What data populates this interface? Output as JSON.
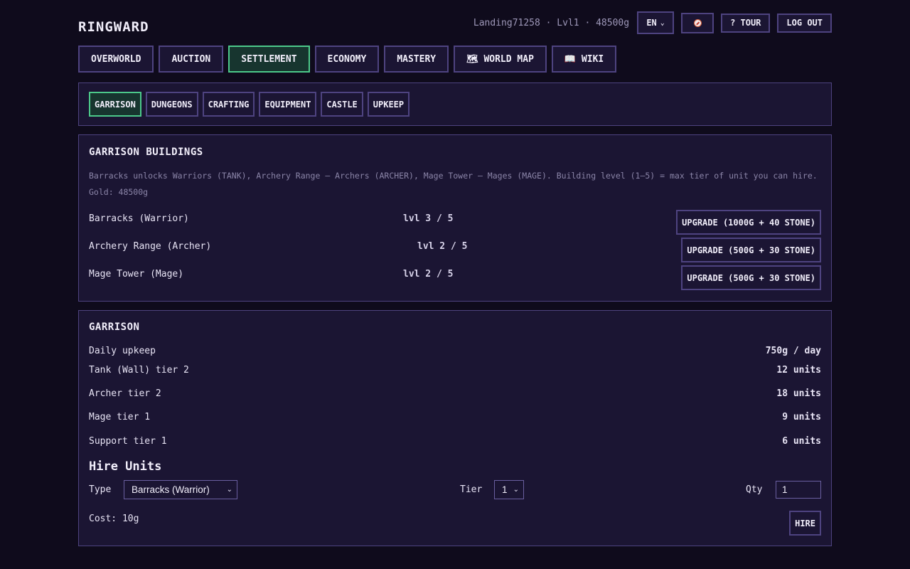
{
  "header": {
    "brand": "RINGWARD",
    "user_info": "Landing71258 · Lvl1 · 48500g",
    "language": "EN",
    "mute_icon": "mute-icon",
    "tour_label": "? TOUR",
    "logout_label": "LOG OUT"
  },
  "nav": {
    "items": [
      {
        "label": "OVERWORLD"
      },
      {
        "label": "AUCTION"
      },
      {
        "label": "SETTLEMENT",
        "active": true
      },
      {
        "label": "ECONOMY"
      },
      {
        "label": "MASTERY"
      },
      {
        "label": "🗺 WORLD MAP"
      },
      {
        "label": "📖 WIKI"
      }
    ]
  },
  "subnav": {
    "items": [
      {
        "label": "GARRISON",
        "active": true
      },
      {
        "label": "DUNGEONS"
      },
      {
        "label": "CRAFTING"
      },
      {
        "label": "EQUIPMENT"
      },
      {
        "label": "CASTLE"
      },
      {
        "label": "UPKEEP"
      }
    ]
  },
  "buildings": {
    "title": "GARRISON BUILDINGS",
    "description": "Barracks unlocks Warriors (TANK), Archery Range — Archers (ARCHER), Mage Tower — Mages (MAGE). Building level (1–5) = max tier of unit you can hire. Gold: 48500g",
    "rows": [
      {
        "name": "Barracks (Warrior)",
        "level": "lvl 3 / 5",
        "upgrade": "UPGRADE (1000G + 40 STONE)"
      },
      {
        "name": "Archery Range (Archer)",
        "level": "lvl 2 / 5",
        "upgrade": "UPGRADE (500G + 30 STONE)"
      },
      {
        "name": "Mage Tower (Mage)",
        "level": "lvl 2 / 5",
        "upgrade": "UPGRADE (500G + 30 STONE)"
      }
    ]
  },
  "garrison": {
    "title": "GARRISON",
    "rows": [
      {
        "label": "Daily upkeep",
        "value": "750g / day"
      },
      {
        "label": "Tank (Wall) tier 2",
        "value": "12 units"
      },
      {
        "label": "Archer tier 2",
        "value": "18 units"
      },
      {
        "label": "Mage tier 1",
        "value": "9 units"
      },
      {
        "label": "Support tier 1",
        "value": "6 units"
      }
    ]
  },
  "hire": {
    "title": "Hire Units",
    "type_label": "Type",
    "type_value": "Barracks (Warrior)",
    "tier_label": "Tier",
    "tier_value": "1",
    "qty_label": "Qty",
    "qty_value": "1",
    "cost": "Cost: 10g",
    "hire_label": "HIRE"
  }
}
